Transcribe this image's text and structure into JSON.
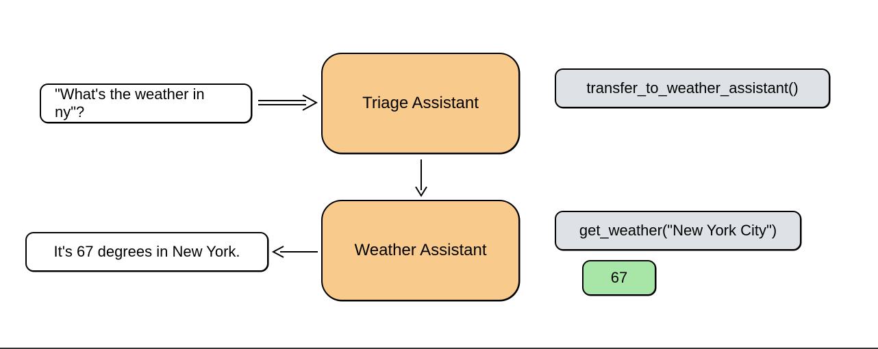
{
  "user_query": "\"What's the weather in ny\"?",
  "triage_assistant_label": "Triage Assistant",
  "transfer_call": "transfer_to_weather_assistant()",
  "weather_assistant_label": "Weather Assistant",
  "get_weather_call": "get_weather(\"New York City\")",
  "weather_result": "67",
  "final_response": "It's 67 degrees in New York.",
  "colors": {
    "assistant_bg": "#f8cb8c",
    "function_bg": "#dee2e6",
    "result_bg": "#a8e6a8",
    "border": "#000000"
  }
}
